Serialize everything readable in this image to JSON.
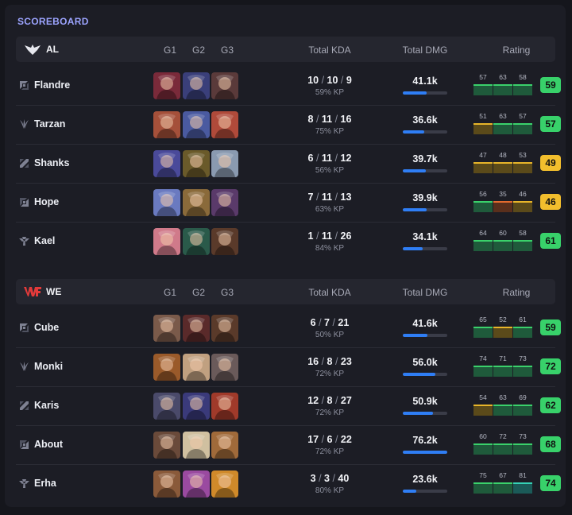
{
  "title": "SCOREBOARD",
  "headers": {
    "g1": "G1",
    "g2": "G2",
    "g3": "G3",
    "kda": "Total KDA",
    "dmg": "Total DMG",
    "rating": "Rating"
  },
  "teams": [
    {
      "name": "AL",
      "players": [
        {
          "name": "Flandre",
          "role": "top-icon",
          "kda": [
            "10",
            "10",
            "9"
          ],
          "kp": "59% KP",
          "dmg": "41.1k",
          "dmg_fill": 0.54,
          "games": [
            {
              "v": "57",
              "c": "green"
            },
            {
              "v": "63",
              "c": "green"
            },
            {
              "v": "58",
              "c": "green"
            }
          ],
          "rating": "59",
          "rating_color": "green",
          "champ_colors": [
            "#7a2a3a",
            "#3a3f7a",
            "#5a3a3a"
          ]
        },
        {
          "name": "Tarzan",
          "role": "jungle-icon",
          "kda": [
            "8",
            "11",
            "16"
          ],
          "kp": "75% KP",
          "dmg": "36.6k",
          "dmg_fill": 0.48,
          "games": [
            {
              "v": "51",
              "c": "yellow"
            },
            {
              "v": "63",
              "c": "green"
            },
            {
              "v": "57",
              "c": "green"
            }
          ],
          "rating": "57",
          "rating_color": "green",
          "champ_colors": [
            "#a5503a",
            "#4a5aa0",
            "#b04a3a"
          ]
        },
        {
          "name": "Shanks",
          "role": "mid-icon",
          "kda": [
            "6",
            "11",
            "12"
          ],
          "kp": "56% KP",
          "dmg": "39.7k",
          "dmg_fill": 0.52,
          "games": [
            {
              "v": "47",
              "c": "yellow"
            },
            {
              "v": "48",
              "c": "yellow"
            },
            {
              "v": "53",
              "c": "yellow"
            }
          ],
          "rating": "49",
          "rating_color": "yellow",
          "champ_colors": [
            "#4a4a9a",
            "#6a5a2a",
            "#8a9ab0"
          ]
        },
        {
          "name": "Hope",
          "role": "bot-icon",
          "kda": [
            "7",
            "11",
            "13"
          ],
          "kp": "63% KP",
          "dmg": "39.9k",
          "dmg_fill": 0.53,
          "games": [
            {
              "v": "56",
              "c": "green"
            },
            {
              "v": "35",
              "c": "orange"
            },
            {
              "v": "46",
              "c": "yellow"
            }
          ],
          "rating": "46",
          "rating_color": "yellow",
          "champ_colors": [
            "#6a7ac0",
            "#8a6a3a",
            "#5a3a6a"
          ]
        },
        {
          "name": "Kael",
          "role": "support-icon",
          "kda": [
            "1",
            "11",
            "26"
          ],
          "kp": "84% KP",
          "dmg": "34.1k",
          "dmg_fill": 0.45,
          "games": [
            {
              "v": "64",
              "c": "green"
            },
            {
              "v": "60",
              "c": "green"
            },
            {
              "v": "58",
              "c": "green"
            }
          ],
          "rating": "61",
          "rating_color": "green",
          "champ_colors": [
            "#d07a8a",
            "#2a5a4a",
            "#5a3a2a"
          ]
        }
      ]
    },
    {
      "name": "WE",
      "players": [
        {
          "name": "Cube",
          "role": "top-icon",
          "kda": [
            "6",
            "7",
            "21"
          ],
          "kp": "50% KP",
          "dmg": "41.6k",
          "dmg_fill": 0.55,
          "games": [
            {
              "v": "65",
              "c": "green"
            },
            {
              "v": "52",
              "c": "yellow"
            },
            {
              "v": "61",
              "c": "green"
            }
          ],
          "rating": "59",
          "rating_color": "green",
          "champ_colors": [
            "#7a5a4a",
            "#5a2a2a",
            "#5a3a2a"
          ]
        },
        {
          "name": "Monki",
          "role": "jungle-icon",
          "kda": [
            "16",
            "8",
            "23"
          ],
          "kp": "72% KP",
          "dmg": "56.0k",
          "dmg_fill": 0.74,
          "games": [
            {
              "v": "74",
              "c": "green"
            },
            {
              "v": "71",
              "c": "green"
            },
            {
              "v": "73",
              "c": "green"
            }
          ],
          "rating": "72",
          "rating_color": "green",
          "champ_colors": [
            "#9a5a2a",
            "#c0a080",
            "#6a5a5a"
          ]
        },
        {
          "name": "Karis",
          "role": "mid-icon",
          "kda": [
            "12",
            "8",
            "27"
          ],
          "kp": "72% KP",
          "dmg": "50.9k",
          "dmg_fill": 0.67,
          "games": [
            {
              "v": "54",
              "c": "yellow"
            },
            {
              "v": "63",
              "c": "green"
            },
            {
              "v": "69",
              "c": "green"
            }
          ],
          "rating": "62",
          "rating_color": "green",
          "champ_colors": [
            "#4a4a6a",
            "#3a3a7a",
            "#a03a2a"
          ]
        },
        {
          "name": "About",
          "role": "bot-icon",
          "kda": [
            "17",
            "6",
            "22"
          ],
          "kp": "72% KP",
          "dmg": "76.2k",
          "dmg_fill": 1.0,
          "games": [
            {
              "v": "60",
              "c": "green"
            },
            {
              "v": "72",
              "c": "green"
            },
            {
              "v": "73",
              "c": "green"
            }
          ],
          "rating": "68",
          "rating_color": "green",
          "champ_colors": [
            "#6a4a3a",
            "#d0c0a0",
            "#a06a3a"
          ]
        },
        {
          "name": "Erha",
          "role": "support-icon",
          "kda": [
            "3",
            "3",
            "40"
          ],
          "kp": "80% KP",
          "dmg": "23.6k",
          "dmg_fill": 0.31,
          "games": [
            {
              "v": "75",
              "c": "green"
            },
            {
              "v": "67",
              "c": "green"
            },
            {
              "v": "81",
              "c": "teal"
            }
          ],
          "rating": "74",
          "rating_color": "green",
          "champ_colors": [
            "#8a5a3a",
            "#9a4aa0",
            "#d08a2a"
          ]
        }
      ]
    }
  ]
}
